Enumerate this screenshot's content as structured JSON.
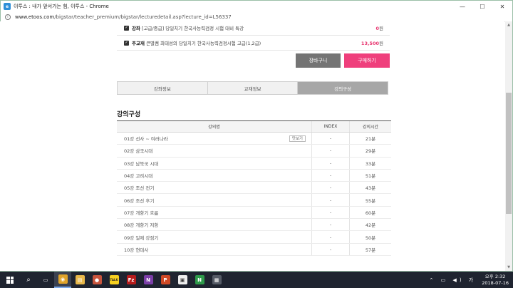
{
  "window": {
    "title": "이투스 : 내가 앞서가는 힘, 이투스 - Chrome",
    "url_host": "www.etoos.com",
    "url_path": "/bigstar/teacher_premium/bigstar/lecturedetail.asp?lecture_id=L56337",
    "app_icon_label": "e",
    "minimize": "—",
    "maximize": "☐",
    "close": "✕"
  },
  "options": [
    {
      "type": "강좌",
      "name": "[고급/중급] 당일치기 한국사능력검정 시험 대비 특강",
      "price": "0",
      "unit": "원",
      "checked": true
    },
    {
      "type": "주교재",
      "name": "큰별쌤 최태성의 당일치기 한국사능력검정시험 고급(1,2급)",
      "price": "13,500",
      "unit": "원",
      "checked": true
    }
  ],
  "buttons": {
    "cart": "장바구니",
    "buy": "구매하기"
  },
  "tabs": [
    {
      "label": "강좌정보",
      "active": false
    },
    {
      "label": "교재정보",
      "active": false
    },
    {
      "label": "강의구성",
      "active": true
    }
  ],
  "section_title": "강의구성",
  "table": {
    "headers": [
      "강의명",
      "INDEX",
      "강의시간"
    ],
    "preview_label": "맛보기",
    "rows": [
      {
        "title": "01강 선사 ~ 여러나라",
        "index": "-",
        "time": "21분",
        "preview": true
      },
      {
        "title": "02강 삼국시대",
        "index": "-",
        "time": "29분",
        "preview": false
      },
      {
        "title": "03강 남북국 시대",
        "index": "-",
        "time": "33분",
        "preview": false
      },
      {
        "title": "04강 고려시대",
        "index": "-",
        "time": "51분",
        "preview": false
      },
      {
        "title": "05강 조선 전기",
        "index": "-",
        "time": "43분",
        "preview": false
      },
      {
        "title": "06강 조선 후기",
        "index": "-",
        "time": "55분",
        "preview": false
      },
      {
        "title": "07강 개항기 흐름",
        "index": "-",
        "time": "60분",
        "preview": false
      },
      {
        "title": "08강 개항기 저항",
        "index": "-",
        "time": "42분",
        "preview": false
      },
      {
        "title": "09강 일제 강점기",
        "index": "-",
        "time": "50분",
        "preview": false
      },
      {
        "title": "10강 현대사",
        "index": "-",
        "time": "57분",
        "preview": false
      }
    ]
  },
  "taskbar": {
    "search_icon": "⌕",
    "apps": [
      {
        "name": "task-view",
        "glyph": "▭",
        "color": "#1f2430"
      },
      {
        "name": "chrome",
        "glyph": "◉",
        "color": "#e0a42a"
      },
      {
        "name": "file-explorer",
        "glyph": "▤",
        "color": "#e8b84a"
      },
      {
        "name": "app-palette",
        "glyph": "●",
        "color": "#c8553d"
      },
      {
        "name": "kakaotalk",
        "glyph": "TALK",
        "color": "#f7d11f"
      },
      {
        "name": "filezilla",
        "glyph": "Fz",
        "color": "#b71c1c"
      },
      {
        "name": "onenote",
        "glyph": "N",
        "color": "#7b3fa8"
      },
      {
        "name": "powerpoint",
        "glyph": "P",
        "color": "#d04a26"
      },
      {
        "name": "app-white",
        "glyph": "▣",
        "color": "#eeeeee"
      },
      {
        "name": "app-green",
        "glyph": "N",
        "color": "#2e9b4a"
      },
      {
        "name": "calculator",
        "glyph": "▦",
        "color": "#555b66"
      }
    ],
    "tray_icons": "⌃ ▭ ◀) 가",
    "time": "오후 2:32",
    "date": "2018-07-16"
  }
}
